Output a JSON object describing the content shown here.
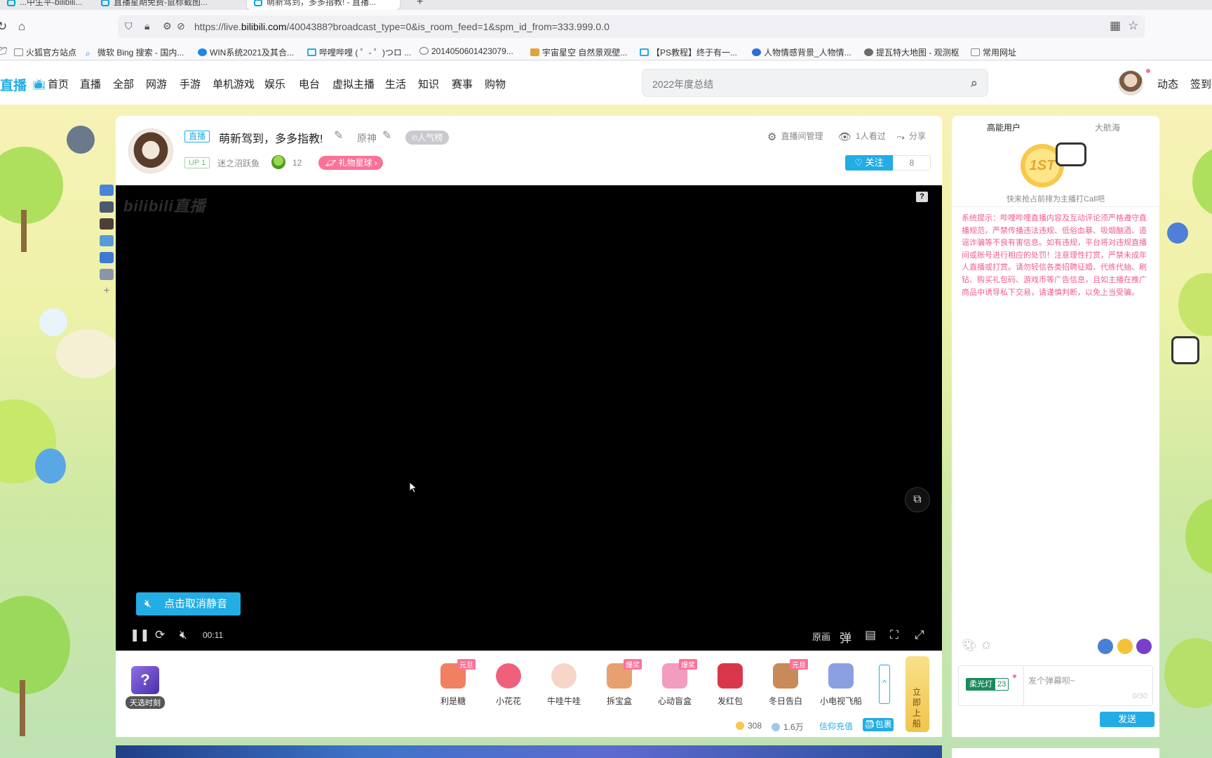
{
  "browser": {
    "tabs": [
      {
        "label": "...中生平-bilibili..."
      },
      {
        "label": "直播星期免费-鼠标截图..."
      },
      {
        "label": "萌新驾到，多多指教! - 直播..."
      }
    ],
    "url_prefix": "https://live.",
    "url_domain": "bilibili.com",
    "url_rest": "/4004388?broadcast_type=0&is_room_feed=1&spm_id_from=333.999.0.0",
    "bookmarks": [
      {
        "label": "火狐官方站点",
        "color": "#888888"
      },
      {
        "label": "微软 Bing 搜索 - 国内...",
        "color": "#2b6fd6"
      },
      {
        "label": "WIN系统2021及其合...",
        "color": "#1e88e5"
      },
      {
        "label": "哔哩哔哩 ( ゜- ゜)つロ ...",
        "color": "#23ade5"
      },
      {
        "label": "2014050601423079...",
        "color": "#777777"
      },
      {
        "label": "宇宙星空 自然景观壁...",
        "color": "#e0a43a"
      },
      {
        "label": "【PS教程】终于有一...",
        "color": "#23ade5"
      },
      {
        "label": "人物情感背景_人物情...",
        "color": "#2b6fd6"
      },
      {
        "label": "提瓦特大地图 - 观测枢",
        "color": "#6b6b6b"
      },
      {
        "label": "常用网址",
        "color": "#888888"
      }
    ]
  },
  "header": {
    "logo": "直播",
    "nav": [
      "首页",
      "直播",
      "全部",
      "网游",
      "手游",
      "单机游戏",
      "娱乐",
      "电台",
      "虚拟主播",
      "生活",
      "知识",
      "赛事",
      "购物"
    ],
    "search_placeholder": "2022年度总结",
    "links": [
      "动态",
      "签到"
    ]
  },
  "room": {
    "live_tag": "直播",
    "title": "萌新驾到，多多指教!",
    "area": "原神",
    "popularity_badge": "人气榜",
    "up_level": "UP 1",
    "up_name": "迷之沼跃鱼",
    "fans": "12",
    "gift_star": "礼物星球 ›",
    "tools": [
      "直播间管理",
      "1人看过",
      "分享"
    ],
    "follow_label": "关注",
    "follow_count": "8"
  },
  "player": {
    "watermark": "bilibili直播",
    "unmute_label": "点击取消静音",
    "time": "00:11",
    "quality": "原画"
  },
  "gifts": {
    "tianxuan": "天选时刻",
    "items": [
      {
        "label": "利是糖",
        "badge": "元旦",
        "color": "#f08060"
      },
      {
        "label": "小花花",
        "badge": "",
        "color": "#f0607a"
      },
      {
        "label": "牛哇牛哇",
        "badge": "",
        "color": "#f5d6c8"
      },
      {
        "label": "拆宝盒",
        "badge": "爆奖",
        "color": "#e8a070"
      },
      {
        "label": "心动盲盒",
        "badge": "爆奖",
        "color": "#f29cc0"
      },
      {
        "label": "发红包",
        "badge": "",
        "color": "#d9364a"
      },
      {
        "label": "冬日告白",
        "badge": "元旦",
        "color": "#c88a58"
      },
      {
        "label": "小电视飞船",
        "badge": "",
        "color": "#8aa0e0"
      }
    ],
    "board_label": "立即上船",
    "battery": "308",
    "silver": "1.6万",
    "recharge": "信仰充值",
    "pack": "包裹"
  },
  "chat": {
    "tabs": [
      "高能用户",
      "大航海"
    ],
    "rank_coin": "1ST",
    "rank_hint": "快来抢占前排为主播打Call吧",
    "system_tip": "系统提示：哔哩哔哩直播内容及互动评论须严格遵守直播规范，严禁传播违法违规、低俗血暴、吸烟酗酒、造谣诈骗等不良有害信息。如有违规，平台将对违规直播间或账号进行相应的处罚！注意理性打赏，严禁未成年人直播或打赏。请勿轻信各类招聘征婚、代练代抽、刷钻、购买礼包码、游戏币等广告信息，且如主播在推广商品中诱导私下交易，请谨慎判断，以免上当受骗。",
    "medal_name": "柔光灯",
    "medal_level": "23",
    "input_placeholder": "发个弹幕呗~",
    "input_count": "0/30",
    "send": "发送"
  }
}
